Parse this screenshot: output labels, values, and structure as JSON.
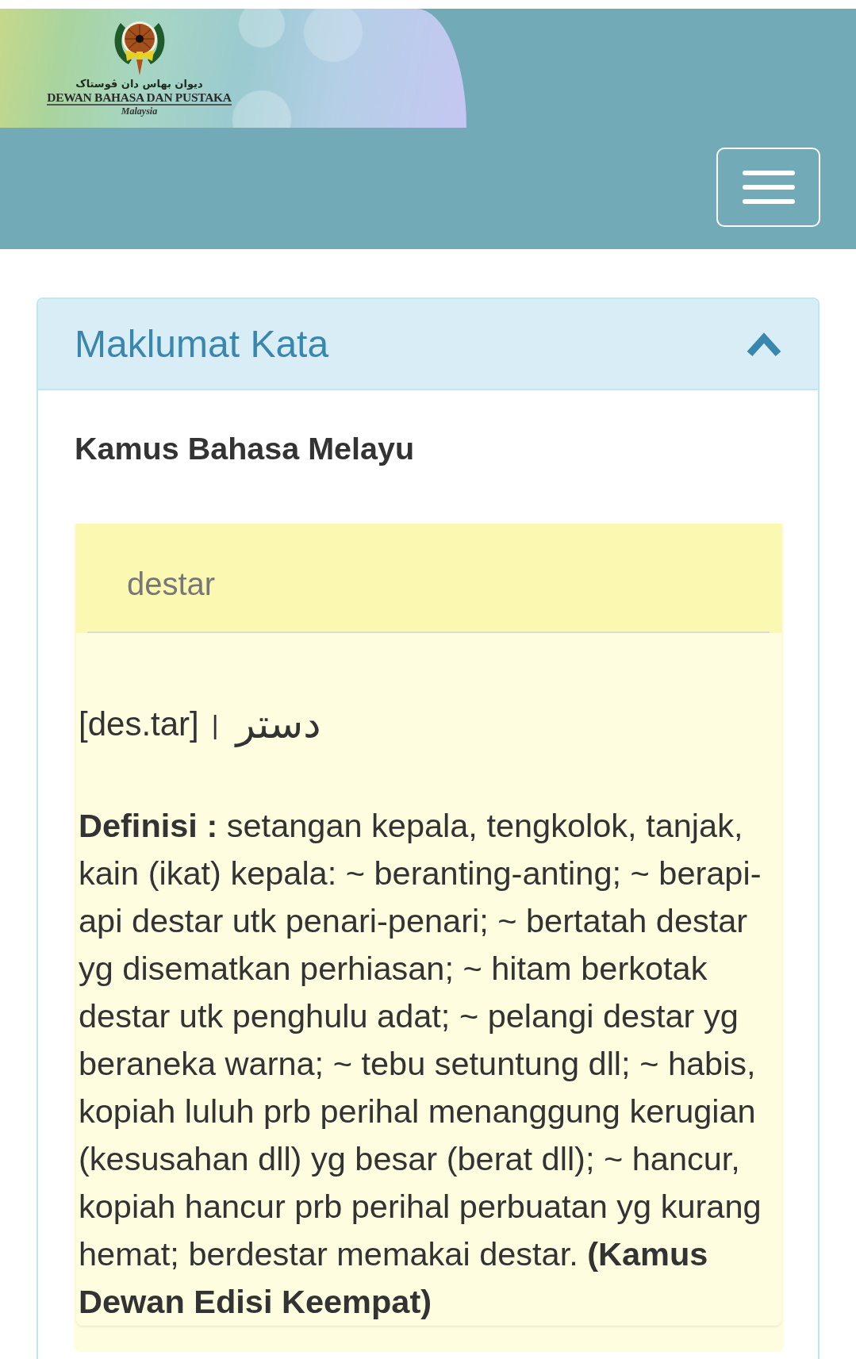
{
  "header": {
    "logo": {
      "jawi": "ديوان بهاس دان ڤوستاک",
      "name": "DEWAN BAHASA DAN PUSTAKA",
      "country": "Malaysia"
    }
  },
  "panel": {
    "title": "Maklumat Kata",
    "expanded": true,
    "dictionary": "Kamus Bahasa Melayu",
    "entry": {
      "headword": "destar",
      "pronunciation": "[des.tar]",
      "separator": "|",
      "jawi": "دستر",
      "definition": "**Definisi :** setangan kepala, tengkolok, tanjak, kain (ikat) kepala: ~ beranting-anting; ~ berapi-api destar utk penari-penari; ~ bertatah destar yg disematkan perhiasan; ~ hitam berkotak destar utk penghulu adat; ~ pelangi destar yg beraneka warna; ~ tebu setuntung dll; ~ habis, kopiah luluh prb perihal menanggung kerugian (kesusahan dll) yg besar (berat dll); ~ hancur, kopiah hancur prb perihal perbuatan yg kurang hemat; berdestar memakai destar. **(Kamus Dewan Edisi Keempat)**"
    }
  }
}
